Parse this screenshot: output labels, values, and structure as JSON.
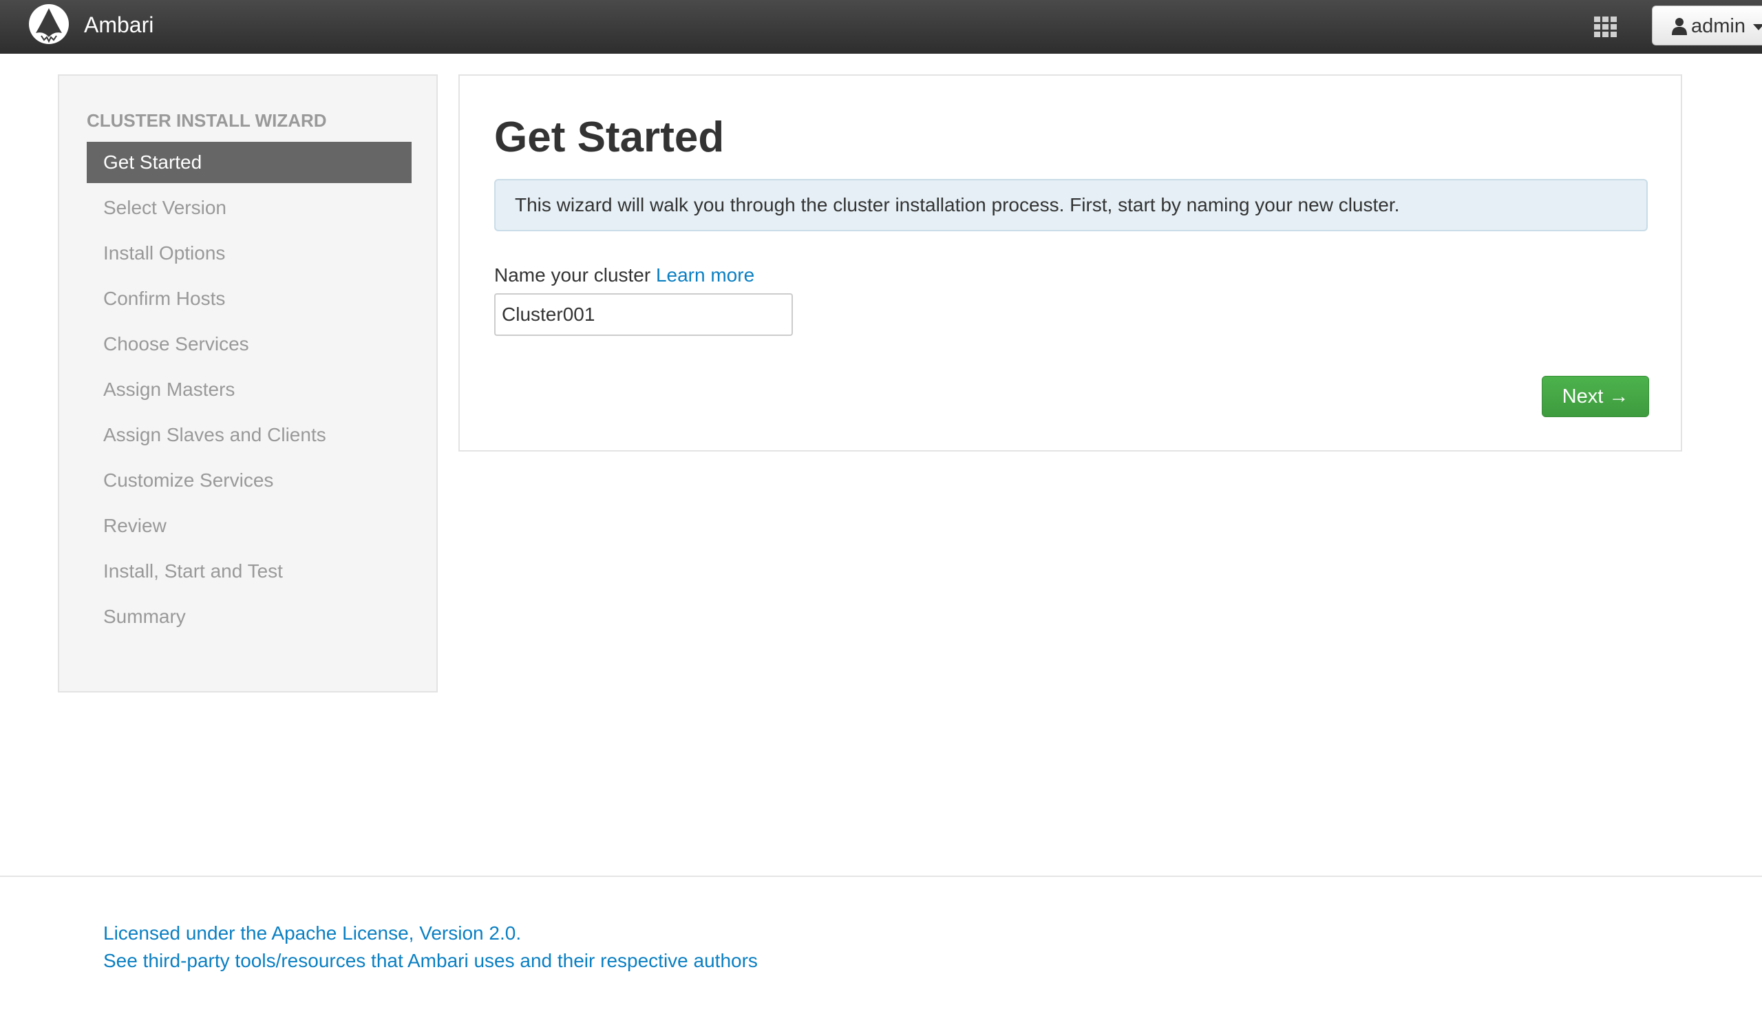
{
  "app": {
    "brand": "Ambari",
    "logo_icon": "ambari-logo-icon",
    "apps_icon": "grid-apps-icon",
    "user": {
      "label": "admin",
      "icon": "user-icon"
    }
  },
  "sidebar": {
    "header": "CLUSTER INSTALL WIZARD",
    "items": [
      {
        "label": "Get Started",
        "active": true
      },
      {
        "label": "Select Version"
      },
      {
        "label": "Install Options"
      },
      {
        "label": "Confirm Hosts"
      },
      {
        "label": "Choose Services"
      },
      {
        "label": "Assign Masters"
      },
      {
        "label": "Assign Slaves and Clients"
      },
      {
        "label": "Customize Services"
      },
      {
        "label": "Review"
      },
      {
        "label": "Install, Start and Test"
      },
      {
        "label": "Summary"
      }
    ]
  },
  "main": {
    "title": "Get Started",
    "alert": "This wizard will walk you through the cluster installation process. First, start by naming your new cluster.",
    "field_label": "Name your cluster",
    "learn_more": "Learn more",
    "cluster_name_value": "Cluster001",
    "next_label": "Next →"
  },
  "footer": {
    "license": "Licensed under the Apache License, Version 2.0.",
    "third_party": "See third-party tools/resources that Ambari uses and their respective authors"
  },
  "colors": {
    "topbar": "#3a3a3a",
    "active_nav": "#666666",
    "link": "#0a7fc2",
    "success": "#45a745",
    "alert_bg": "#e5eff5"
  }
}
